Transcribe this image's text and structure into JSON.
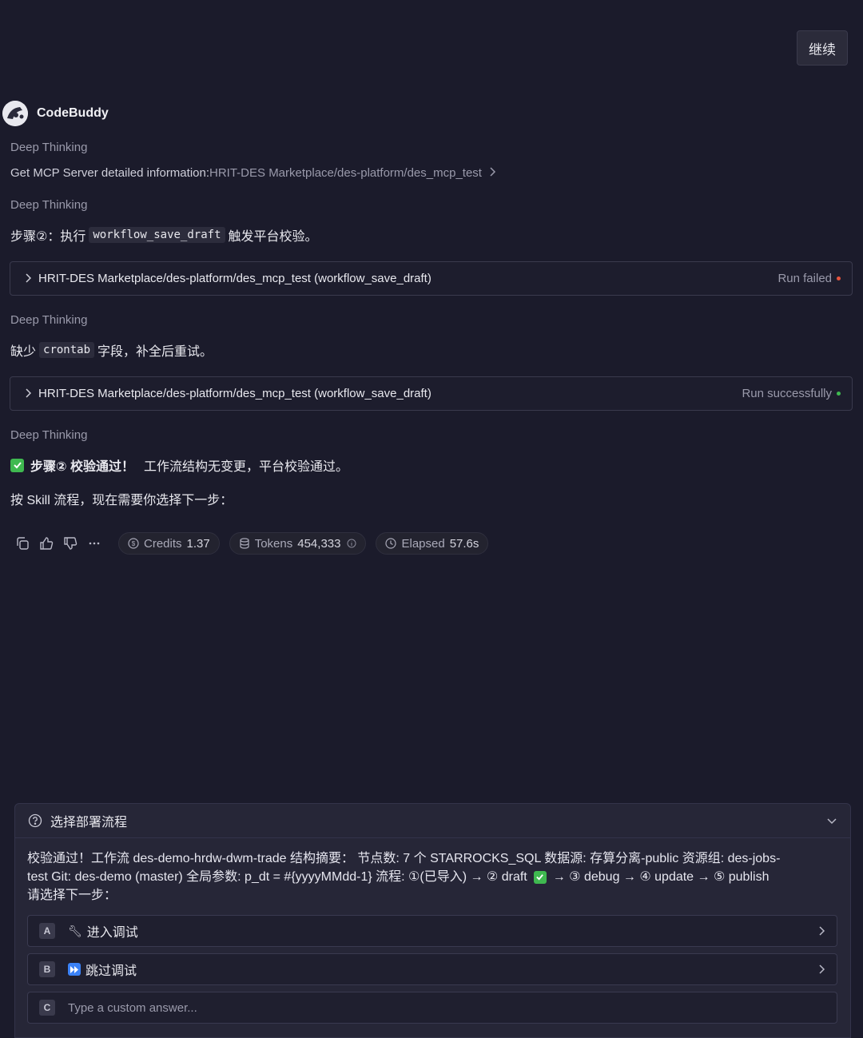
{
  "continue_button": "继续",
  "bot": {
    "name": "CodeBuddy"
  },
  "thinking_label": "Deep Thinking",
  "mcp_info": {
    "prefix": "Get MCP Server detailed information: ",
    "path": "HRIT-DES Marketplace/des-platform/des_mcp_test"
  },
  "step1": {
    "before": "步骤②：执行",
    "code": "workflow_save_draft",
    "after": "触发平台校验。"
  },
  "tool1": {
    "label": "HRIT-DES Marketplace/des-platform/des_mcp_test (workflow_save_draft)",
    "status": "Run failed",
    "status_color": "#e5533d"
  },
  "step2": {
    "before": "缺少",
    "code": "crontab",
    "after": "字段，补全后重试。"
  },
  "tool2": {
    "label": "HRIT-DES Marketplace/des-platform/des_mcp_test (workflow_save_draft)",
    "status": "Run successfully",
    "status_color": "#3fb950"
  },
  "result": {
    "bold": "步骤② 校验通过！",
    "rest": "工作流结构无变更，平台校验通过。"
  },
  "next_step": "按 Skill 流程，现在需要你选择下一步：",
  "stats": {
    "credits_label": "Credits",
    "credits_value": "1.37",
    "tokens_label": "Tokens",
    "tokens_value": "454,333",
    "elapsed_label": "Elapsed",
    "elapsed_value": "57.6s"
  },
  "panel": {
    "title": "选择部署流程",
    "body_line1": "校验通过！工作流 des-demo-hrdw-dwm-trade 结构摘要： 节点数: 7 个 STARROCKS_SQL 数据源: 存算分离-public 资源组: des-jobs-",
    "body_line2a": "test Git: des-demo (master) 全局参数: p_dt = #{yyyyMMdd-1} 流程: ①(已导入) → ② draft",
    "body_line2b": "→ ③ debug → ④ update → ⑤ publish",
    "body_line3": "请选择下一步：",
    "options": [
      {
        "key": "A",
        "label": "进入调试"
      },
      {
        "key": "B",
        "label": "跳过调试"
      },
      {
        "key": "C",
        "placeholder": "Type a custom answer..."
      }
    ]
  }
}
